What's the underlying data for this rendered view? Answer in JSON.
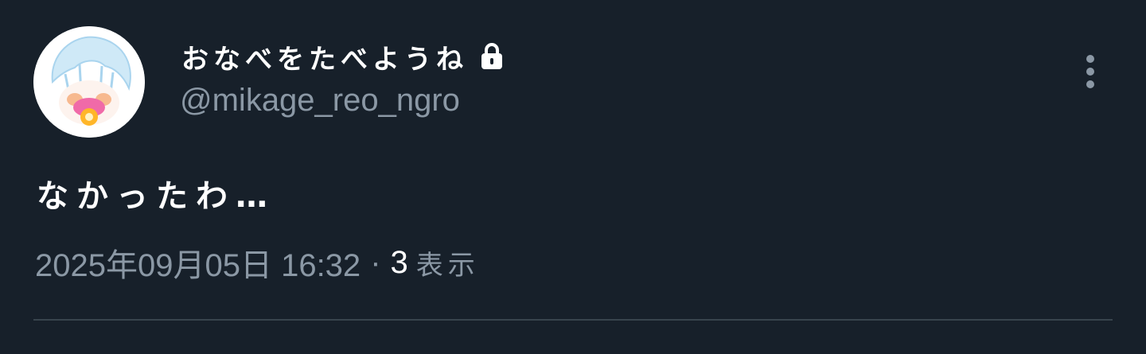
{
  "author": {
    "display_name": "おなべをたべようね",
    "handle": "@mikage_reo_ngro",
    "protected_icon": "lock-icon",
    "avatar_icon": "avatar-illustration"
  },
  "tweet": {
    "text": "なかったわ…"
  },
  "meta": {
    "timestamp": "2025年09月05日 16:32",
    "separator": "·",
    "views_count": "3",
    "views_label": "表示"
  },
  "actions": {
    "more_icon": "more-vertical-icon"
  },
  "colors": {
    "background": "#17202a",
    "primary_text": "#ffffff",
    "secondary_text": "#8b98a5",
    "divider": "#38444d"
  }
}
